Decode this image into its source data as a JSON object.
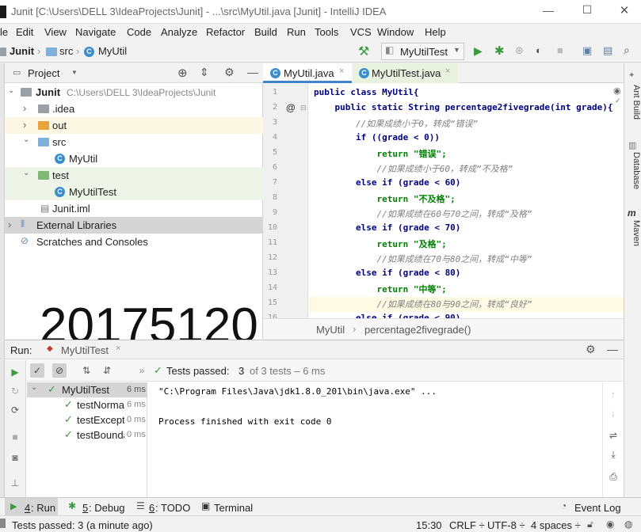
{
  "window": {
    "title": "Junit [C:\\Users\\DELL 3\\IdeaProjects\\Junit] - ...\\src\\MyUtil.java [Junit] - IntelliJ IDEA",
    "controls": [
      "—",
      "☐",
      "✕"
    ]
  },
  "menu": [
    "Edit",
    "View",
    "Navigate",
    "Code",
    "Analyze",
    "Refactor",
    "Build",
    "Run",
    "Tools",
    "VCS",
    "Window",
    "Help"
  ],
  "menu_first": "le",
  "breadcrumb": {
    "project": "Junit",
    "folder": "src",
    "file": "MyUtil"
  },
  "run_config": "MyUtilTest",
  "project_panel": {
    "title": "Project",
    "root_name": "Junit",
    "root_path": "C:\\Users\\DELL 3\\IdeaProjects\\Junit",
    "items": [
      ".idea",
      "out",
      "src",
      "MyUtil",
      "test",
      "MyUtilTest",
      "Junit.iml",
      "External Libraries",
      "Scratches and Consoles"
    ]
  },
  "editor": {
    "tabs": [
      "MyUtil.java",
      "MyUtilTest.java"
    ],
    "line_numbers": [
      "1",
      "2",
      "3",
      "4",
      "5",
      "6",
      "7",
      "8",
      "9",
      "10",
      "11",
      "12",
      "13",
      "14",
      "15",
      "16"
    ],
    "lines": [
      "public class MyUtil{",
      "    public static String percentage2fivegrade(int grade){",
      "        //如果成绩小于0，转成“错误”",
      "        if ((grade < 0))",
      "            return \"错误\";",
      "            //如果成绩小于60，转成“不及格”",
      "        else if (grade < 60)",
      "            return \"不及格\";",
      "            //如果成绩在60与70之间，转成“及格”",
      "        else if (grade < 70)",
      "            return \"及格\";",
      "            //如果成绩在70与80之间，转成“中等”",
      "        else if (grade < 80)",
      "            return \"中等\";",
      "            //如果成绩在80与90之间，转成“良好”",
      "        else if (grade < 90)"
    ],
    "crumbs": [
      "MyUtil",
      "percentage2fivegrade()"
    ]
  },
  "overlay_number": "20175120",
  "right_tabs": [
    "Ant Build",
    "Database",
    "Maven"
  ],
  "run_panel": {
    "label": "Run:",
    "tab": "MyUtilTest",
    "status_prefix": "Tests passed:",
    "passed": "3",
    "of_text": "of 3 tests – 6 ms",
    "tree": [
      {
        "name": "MyUtilTest",
        "time": "6 ms"
      },
      {
        "name": "testNormal",
        "time": "6 ms"
      },
      {
        "name": "testException",
        "time": "0 ms"
      },
      {
        "name": "testBoundary",
        "time": "0 ms"
      }
    ],
    "console": [
      "\"C:\\Program Files\\Java\\jdk1.8.0_201\\bin\\java.exe\" ...",
      "",
      "Process finished with exit code 0"
    ]
  },
  "bottom_tabs": [
    {
      "key": "4",
      "label": ": Run"
    },
    {
      "key": "5",
      "label": ": Debug"
    },
    {
      "key": "6",
      "label": ": TODO"
    },
    {
      "key": "",
      "label": "Terminal"
    }
  ],
  "event_log": "Event Log",
  "status": {
    "left": "Tests passed: 3 (a minute ago)",
    "pos": "15:30",
    "line_sep": "CRLF ÷",
    "encoding": "UTF-8 ÷",
    "indent": "4 spaces ÷"
  },
  "colors": {
    "keyword": "#000080",
    "comment": "#808080",
    "string": "#008000",
    "pass": "#3c9a3c",
    "selection": "#d5d5d5"
  }
}
